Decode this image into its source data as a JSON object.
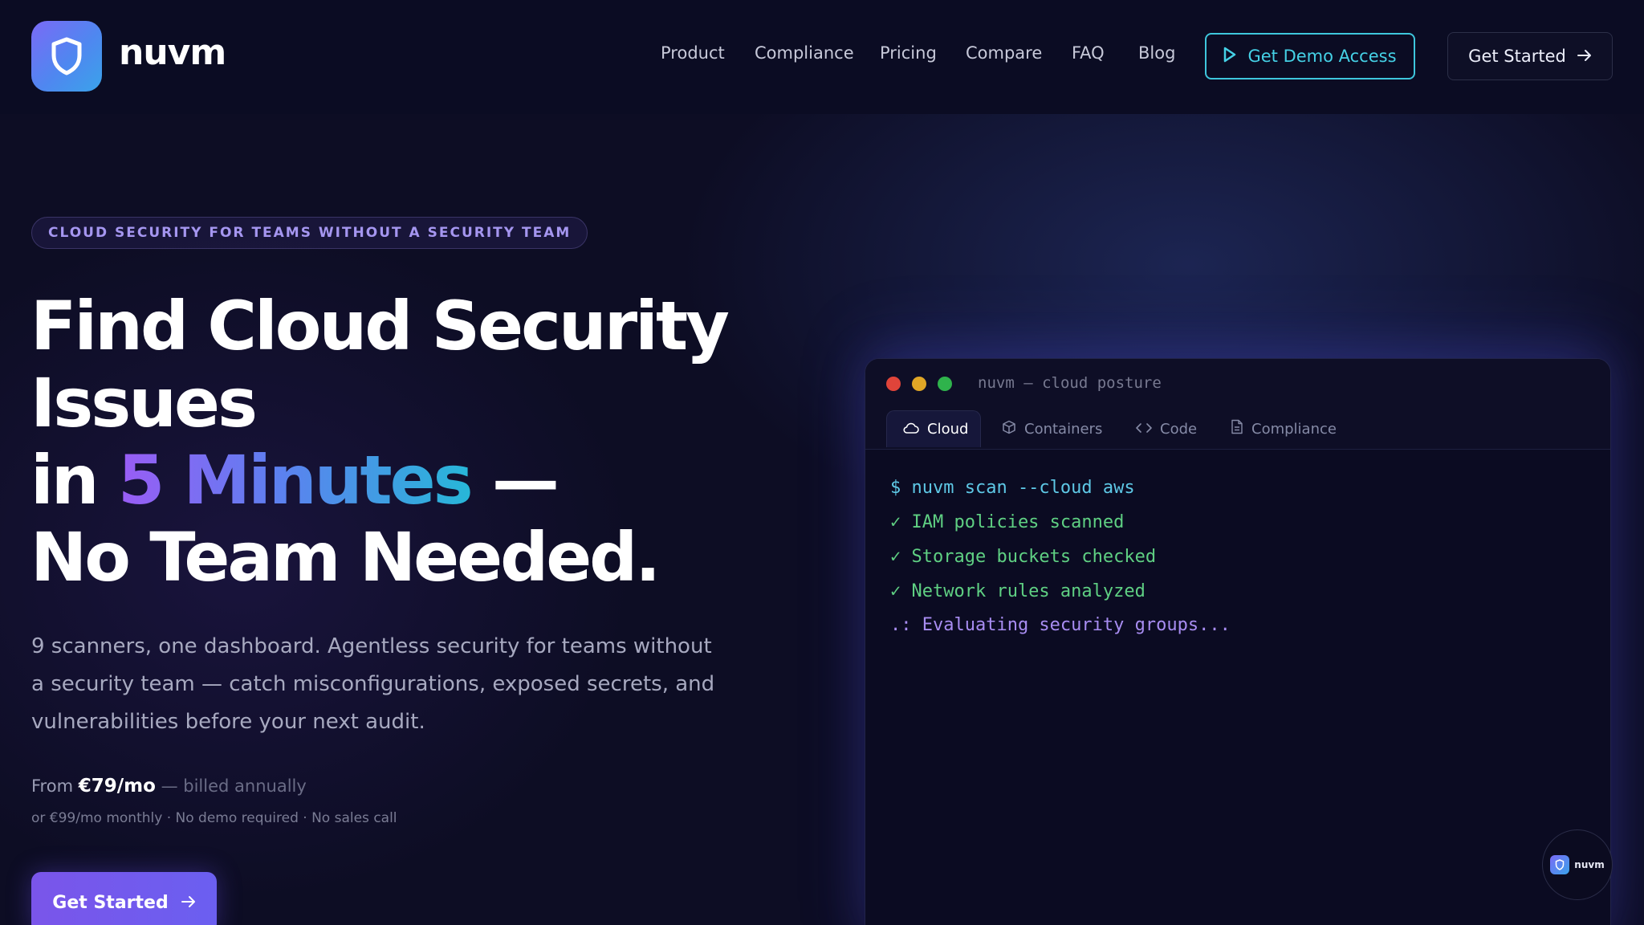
{
  "brand": {
    "name": "nuvm"
  },
  "nav": {
    "items": [
      "Product",
      "Compliance",
      "Pricing",
      "Compare",
      "FAQ",
      "Blog"
    ],
    "demo_label": "Get Demo Access",
    "start_label": "Get Started"
  },
  "hero": {
    "eyebrow": "CLOUD SECURITY FOR TEAMS WITHOUT A SECURITY TEAM",
    "headline": {
      "line1": "Find Cloud Security",
      "line2": "Issues",
      "line3_prefix": "in ",
      "line3_highlight": "5 Minutes",
      "line3_suffix": " —",
      "line4": "No Team Needed."
    },
    "subhead": "9 scanners, one dashboard. Agentless security for teams without a security team — catch misconfigurations, exposed secrets, and vulnerabilities before your next audit.",
    "pricing": {
      "from": "From",
      "amount": "€79/mo",
      "billed": "— billed annually",
      "note": "or €99/mo monthly · No demo required · No sales call"
    },
    "cta_label": "Get Started"
  },
  "terminal": {
    "title": "nuvm — cloud posture",
    "tabs": [
      {
        "label": "Cloud",
        "icon": "cloud-icon",
        "active": true
      },
      {
        "label": "Containers",
        "icon": "cube-icon",
        "active": false
      },
      {
        "label": "Code",
        "icon": "code-icon",
        "active": false
      },
      {
        "label": "Compliance",
        "icon": "document-icon",
        "active": false
      }
    ],
    "lines": [
      {
        "text": "$ nuvm scan --cloud aws",
        "status": "command",
        "color": "#5ec8e6"
      },
      {
        "text": "✓ IAM policies scanned",
        "status": "done",
        "color": "#5fd083"
      },
      {
        "text": "✓ Storage buckets checked",
        "status": "done",
        "color": "#5fd083"
      },
      {
        "text": "✓ Network rules analyzed",
        "status": "done",
        "color": "#5fd083"
      },
      {
        "text": ".: Evaluating security groups...",
        "status": "running",
        "color": "#a88df2"
      }
    ]
  },
  "badge": {
    "label": "nuvm"
  },
  "colors": {
    "background": "#0d0d24",
    "accent_purple": "#7a55ea",
    "accent_cyan": "#3ec6dc",
    "gradient": [
      "#9a5cf5",
      "#5d80f0",
      "#27b7d8"
    ],
    "dot_red": "#e0443a",
    "dot_yellow": "#e0a626",
    "dot_green": "#2fb34c"
  }
}
